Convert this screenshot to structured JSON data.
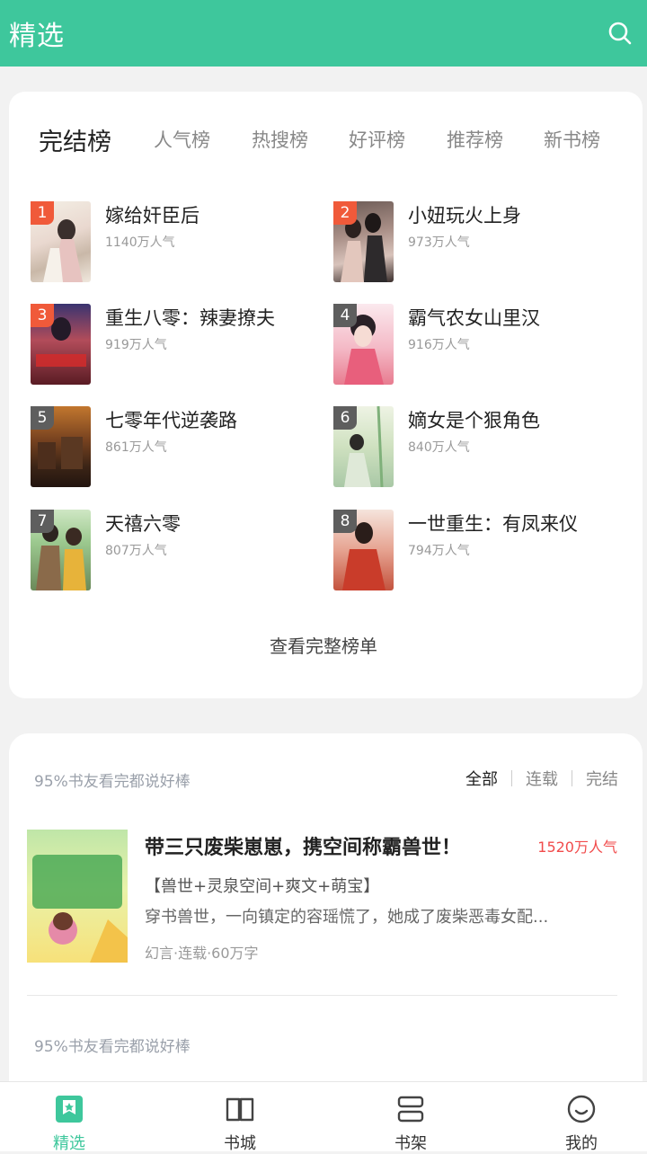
{
  "header": {
    "title": "精选",
    "search_icon": "search-icon"
  },
  "ranking": {
    "tabs": [
      "完结榜",
      "人气榜",
      "热搜榜",
      "好评榜",
      "推荐榜",
      "新书榜"
    ],
    "active_tab": "完结榜",
    "books": [
      {
        "rank": "1",
        "title": "嫁给奸臣后",
        "popularity": "1140万人气"
      },
      {
        "rank": "2",
        "title": "小妞玩火上身",
        "popularity": "973万人气"
      },
      {
        "rank": "3",
        "title": "重生八零：辣妻撩夫",
        "popularity": "919万人气"
      },
      {
        "rank": "4",
        "title": "霸气农女山里汉",
        "popularity": "916万人气"
      },
      {
        "rank": "5",
        "title": "七零年代逆袭路",
        "popularity": "861万人气"
      },
      {
        "rank": "6",
        "title": "嫡女是个狠角色",
        "popularity": "840万人气"
      },
      {
        "rank": "7",
        "title": "天禧六零",
        "popularity": "807万人气"
      },
      {
        "rank": "8",
        "title": "一世重生：有凤来仪",
        "popularity": "794万人气"
      }
    ],
    "view_all": "查看完整榜单"
  },
  "recommend": {
    "headline": "95%书友看完都说好棒",
    "filters": [
      "全部",
      "连载",
      "完结"
    ],
    "active_filter": "全部",
    "feature": {
      "title": "带三只废柴崽崽，携空间称霸兽世！",
      "popularity": "1520万人气",
      "tags": "【兽世+灵泉空间+爽文+萌宝】",
      "description": "穿书兽世，一向镇定的容瑶慌了，她成了废柴恶毒女配...",
      "meta": "幻言·连载·60万字"
    },
    "headline2": "95%书友看完都说好棒"
  },
  "bottom_nav": [
    {
      "label": "精选",
      "icon": "featured-icon",
      "active": true
    },
    {
      "label": "书城",
      "icon": "book-icon",
      "active": false
    },
    {
      "label": "书架",
      "icon": "bookshelf-icon",
      "active": false
    },
    {
      "label": "我的",
      "icon": "profile-icon",
      "active": false
    }
  ],
  "colors": {
    "accent": "#3ec79c",
    "rank_top": "#f05a3a",
    "popularity_red": "#f14b4b"
  }
}
